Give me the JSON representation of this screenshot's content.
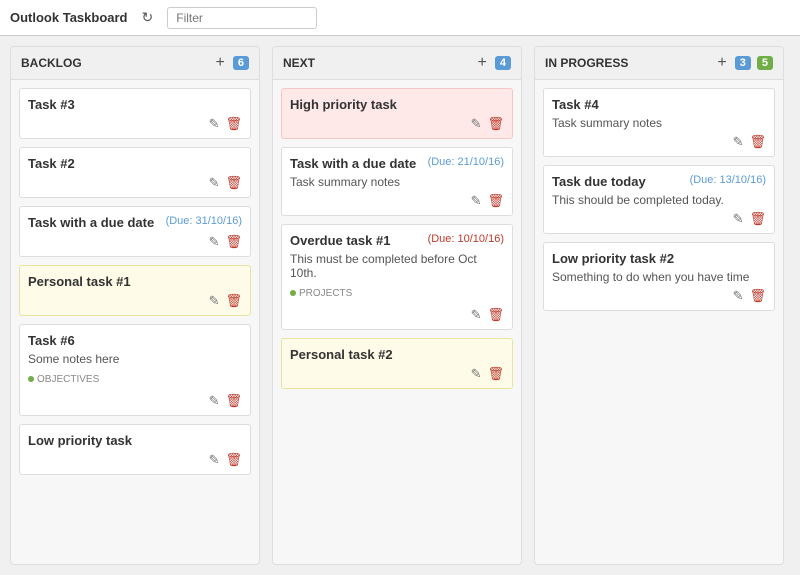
{
  "header": {
    "title": "Outlook Taskboard",
    "refresh_label": "⟳",
    "filter_placeholder": "Filter"
  },
  "columns": [
    {
      "id": "backlog",
      "title": "BACKLOG",
      "badge": "6",
      "badge_color": "blue",
      "cards": [
        {
          "id": "task3",
          "title": "Task #3",
          "due": null,
          "notes": null,
          "tag": null,
          "priority": "normal"
        },
        {
          "id": "task2",
          "title": "Task #2",
          "due": null,
          "notes": null,
          "tag": null,
          "priority": "normal"
        },
        {
          "id": "task-due-date",
          "title": "Task with a due date",
          "due": "(Due: 31/10/16)",
          "due_class": "normal",
          "notes": null,
          "tag": null,
          "priority": "normal"
        },
        {
          "id": "personal1",
          "title": "Personal task #1",
          "due": null,
          "notes": null,
          "tag": null,
          "priority": "personal"
        },
        {
          "id": "task6",
          "title": "Task #6",
          "due": null,
          "notes": "Some notes here",
          "tag": "OBJECTIVES",
          "priority": "normal"
        },
        {
          "id": "low-priority",
          "title": "Low priority task",
          "due": null,
          "notes": null,
          "tag": null,
          "priority": "normal"
        }
      ]
    },
    {
      "id": "next",
      "title": "NEXT",
      "badge": "4",
      "badge_color": "blue",
      "cards": [
        {
          "id": "high-priority",
          "title": "High priority task",
          "due": null,
          "notes": null,
          "tag": null,
          "priority": "high"
        },
        {
          "id": "task-due",
          "title": "Task with a due date",
          "due": "(Due: 21/10/16)",
          "due_class": "normal",
          "notes": "Task summary notes",
          "tag": null,
          "priority": "normal"
        },
        {
          "id": "overdue1",
          "title": "Overdue task #1",
          "due": "(Due: 10/10/16)",
          "due_class": "overdue",
          "notes": "This must be completed before Oct 10th.",
          "tag": "PROJECTS",
          "priority": "normal"
        },
        {
          "id": "personal2",
          "title": "Personal task #2",
          "due": null,
          "notes": null,
          "tag": null,
          "priority": "personal"
        }
      ]
    },
    {
      "id": "inprogress",
      "title": "IN PROGRESS",
      "badge1": "3",
      "badge2": "5",
      "badge_color": "blue",
      "badge2_color": "green",
      "cards": [
        {
          "id": "task4",
          "title": "Task #4",
          "due": null,
          "notes": "Task summary notes",
          "tag": null,
          "priority": "normal"
        },
        {
          "id": "task-due-today",
          "title": "Task due today",
          "due": "(Due: 13/10/16)",
          "due_class": "normal",
          "notes": "This should be completed today.",
          "tag": null,
          "priority": "normal"
        },
        {
          "id": "low-priority2",
          "title": "Low priority task #2",
          "due": null,
          "notes": "Something to do when you have time",
          "tag": null,
          "priority": "normal"
        }
      ]
    }
  ],
  "icons": {
    "edit": "✎",
    "delete": "🗑",
    "tag": "🏷"
  }
}
